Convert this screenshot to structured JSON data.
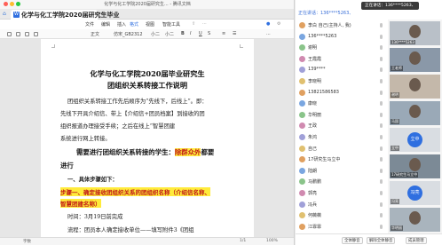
{
  "window": {
    "title": "化学与化工学院2020届研究生... - 腾讯文档"
  },
  "tabs": [
    {
      "label": "化学与化工学院2020届研究生毕业"
    }
  ],
  "menu": [
    "文件",
    "编辑",
    "插入",
    "格式",
    "视图",
    "智能工具"
  ],
  "menu_active": "格式",
  "toolbar": {
    "style": "正文",
    "font": "仿宋_GB2312",
    "size": "小二",
    "size2": "小二",
    "more": "..."
  },
  "document": {
    "title_line1": "化学与化工学院2020届毕业研究生",
    "title_line2": "团组织关系转接工作说明",
    "para1": [
      "团组织关系转接工作先后顺序为“先线下，后线上”。即：",
      "先线下开具介绍信、带上【介绍信+团员档案】到接收的团",
      "组织报道办理接受手续；之后在线上“智慧团建",
      "系统进行网上转接。"
    ],
    "heading_main": "需要进行团组织关系转接的学生：",
    "heading_highlight": "除群众外",
    "heading_tail": "都要",
    "heading_line2": "进行",
    "section1": "一、具体步骤如下：",
    "step1_line1": "步骤一、确定接收团组织关系的团组织名称（介绍信名称、",
    "step1_line2": "智慧团建名称）",
    "time_line": "时间：3月19日前完成",
    "process_line": "流程：团员本人确定接收单位——填写附件3《团组"
  },
  "statusbar": {
    "left": "字数",
    "page": "1/1",
    "zoom": "100%"
  },
  "meeting": {
    "speaking_label": "正在讲话：136****5263、",
    "speaking_badge": "正在讲话：136****5263、",
    "participants": [
      "李白 自己(主持人, 我)",
      "136****5263",
      "谢明",
      "王霞霞",
      "139****",
      "李晓明",
      "13821586583",
      "康晓",
      "华明丽",
      "王政",
      "朱鸿",
      "自己",
      "17研究生马立中",
      "陆朗",
      "马鹏鹏",
      "郭亮",
      "冯兵",
      "何薇薇",
      "江霏霏"
    ],
    "videos": [
      {
        "caption": "136****5263",
        "kind": "photo"
      },
      {
        "caption": "王老师",
        "kind": "photo"
      },
      {
        "caption": "谢明",
        "kind": "photo"
      },
      {
        "caption": "马国",
        "kind": "photo"
      },
      {
        "caption": "立中",
        "kind": "avatar",
        "initial": "立中"
      },
      {
        "caption": "17研究生马立中",
        "kind": "photo"
      },
      {
        "caption": "冯亮",
        "kind": "avatar",
        "initial": "冯亮"
      },
      {
        "caption": "华明丽",
        "kind": "photo"
      }
    ],
    "bottom": [
      "全体静音",
      "解除全体静音",
      "成员管理"
    ]
  },
  "colors": {
    "accent": "#2f6fe0",
    "highlight": "#ffeb3b",
    "step_red": "#c01818"
  }
}
